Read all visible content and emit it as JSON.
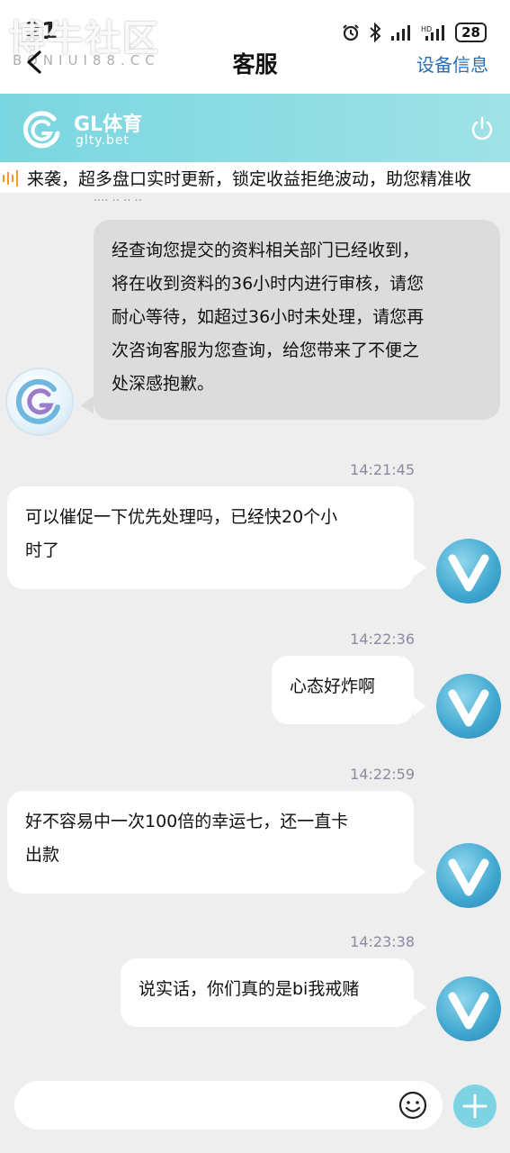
{
  "status_bar": {
    "time": "21",
    "battery": "28"
  },
  "watermark": {
    "text": "博牛社区",
    "sub": "BONIUI88.CC"
  },
  "header": {
    "title": "客服",
    "device_info": "设备信息"
  },
  "brand": {
    "name": "GL体育",
    "domain": "glty.bet",
    "accent": "#7ad6e0"
  },
  "marquee": {
    "text": "来袭，超多盘口实时更新，锁定收益拒绝波动，助您精准收"
  },
  "chat": {
    "cut_timestamp": "····  ·· ·· ··",
    "messages": [
      {
        "sender": "agent",
        "lines": [
          "经查询您提交的资料相关部门已经收到，",
          "将在收到资料的36小时内进行审核，请您",
          "耐心等待，如超过36小时未处理，请您再",
          "次咨询客服为您查询，给您带来了不便之",
          "处深感抱歉。"
        ]
      },
      {
        "sender": "user",
        "time": "14:21:45",
        "lines": [
          "可以催促一下优先处理吗，已经快20个小",
          "时了"
        ]
      },
      {
        "sender": "user",
        "time": "14:22:36",
        "lines": [
          "心态好炸啊"
        ]
      },
      {
        "sender": "user",
        "time": "14:22:59",
        "lines": [
          "好不容易中一次100倍的幸运七，还一直卡",
          "出款"
        ]
      },
      {
        "sender": "user",
        "time": "14:23:38",
        "lines": [
          "说实话，你们真的是bi我戒赌"
        ]
      }
    ]
  },
  "input": {
    "placeholder": ""
  },
  "icons": {
    "back": "back-arrow-icon",
    "power": "power-icon",
    "emoji": "emoji-icon",
    "plus": "plus-icon",
    "user_avatar": "v-logo-icon",
    "agent_avatar": "gl-logo-icon"
  }
}
